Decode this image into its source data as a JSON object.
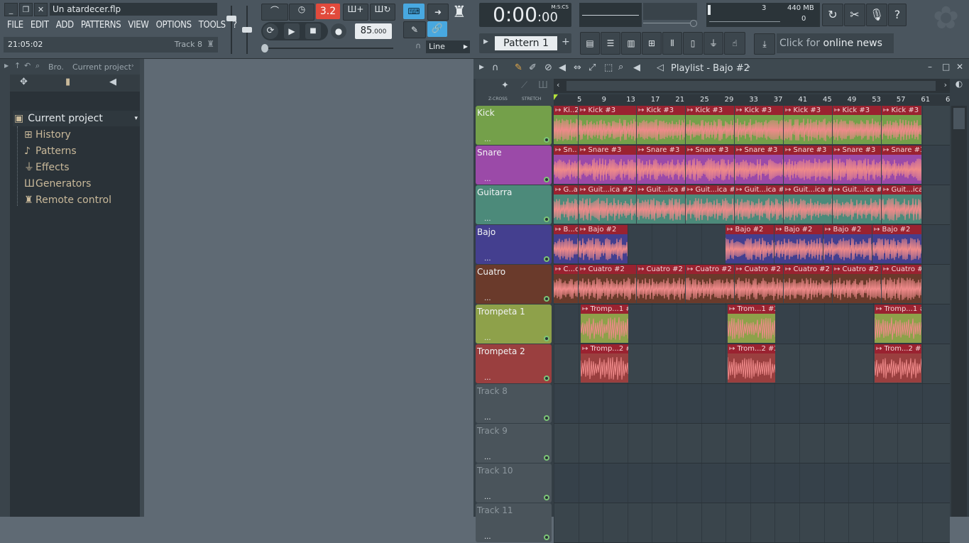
{
  "window": {
    "title": "Un atardecer.flp"
  },
  "menu": [
    "FILE",
    "EDIT",
    "ADD",
    "PATTERNS",
    "VIEW",
    "OPTIONS",
    "TOOLS",
    "?"
  ],
  "hint": {
    "time": "21:05:02",
    "track": "Track 8"
  },
  "transport": {
    "pattern_song": "3.2",
    "tempo": "85",
    "tempo_dec": ".000",
    "snap": "Line",
    "time": "0:00",
    "time_cs": "00",
    "time_unit": "M:S:CS"
  },
  "pattern": {
    "name": "Pattern 1"
  },
  "meter": {
    "cpu": "3",
    "mem": "440 MB",
    "poly": "0"
  },
  "news": {
    "prefix": "Click for",
    "main": "online news"
  },
  "browser": {
    "header_left": "Bro.",
    "header_right": "Current project",
    "root": "Current project",
    "items": [
      {
        "label": "History",
        "icon": "history-icon"
      },
      {
        "label": "Patterns",
        "icon": "note-icon"
      },
      {
        "label": "Effects",
        "icon": "plug-icon"
      },
      {
        "label": "Generators",
        "icon": "piano-icon"
      },
      {
        "label": "Remote control",
        "icon": "remote-icon"
      }
    ]
  },
  "playlist": {
    "title": "Playlist - Bajo #2",
    "labels": {
      "zcross": "Z-CROSS",
      "stretch": "STRETCH"
    },
    "ruler": [
      "5",
      "9",
      "13",
      "17",
      "21",
      "25",
      "29",
      "33",
      "37",
      "41",
      "45",
      "49",
      "53",
      "57",
      "61",
      "6"
    ],
    "tracks": [
      {
        "name": "Kick",
        "color": "#74a04a",
        "clips": [
          "Ki..2",
          "Kick #3",
          "Kick #3",
          "Kick #3",
          "Kick #3",
          "Kick #3",
          "Kick #3",
          "Kick #3"
        ]
      },
      {
        "name": "Snare",
        "color": "#9b4aa8",
        "clips": [
          "Sn..",
          "Snare #3",
          "Snare #3",
          "Snare #3",
          "Snare #3",
          "Snare #3",
          "Snare #3",
          "Snare #3"
        ]
      },
      {
        "name": "Guitarra",
        "color": "#4c8a7a",
        "clips": [
          "G..a",
          "Guit...ica #2",
          "Guit...ica #2",
          "Guit...ica #2",
          "Guit...ica #2",
          "Guit...ica #2",
          "Guit...ica #2",
          "Guit...ica #2"
        ]
      },
      {
        "name": "Bajo",
        "color": "#443f8f",
        "clips": [
          "B...o",
          "Bajo #2",
          "Bajo #2",
          "Bajo #2",
          "Bajo #2",
          "Bajo #2"
        ]
      },
      {
        "name": "Cuatro",
        "color": "#6a3a2b",
        "clips": [
          "C...o",
          "Cuatro #2",
          "Cuatro #2",
          "Cuatro #2",
          "Cuatro #2",
          "Cuatro #2",
          "Cuatro #2",
          "Cuatro #2"
        ]
      },
      {
        "name": "Trompeta 1",
        "color": "#8ea14a",
        "clips": [
          "Tromp...1 #2",
          "Trom...1 #2",
          "Tromp...1 #2"
        ]
      },
      {
        "name": "Trompeta 2",
        "color": "#9a3f3f",
        "clips": [
          "Tromp...2 #2",
          "Trom...2 #2",
          "Trom...2 #2"
        ]
      },
      {
        "name": "Track 8",
        "color": "#4a545b",
        "clips": []
      },
      {
        "name": "Track 9",
        "color": "#4a545b",
        "clips": []
      },
      {
        "name": "Track 10",
        "color": "#4a545b",
        "clips": []
      },
      {
        "name": "Track 11",
        "color": "#4a545b",
        "clips": []
      }
    ]
  }
}
